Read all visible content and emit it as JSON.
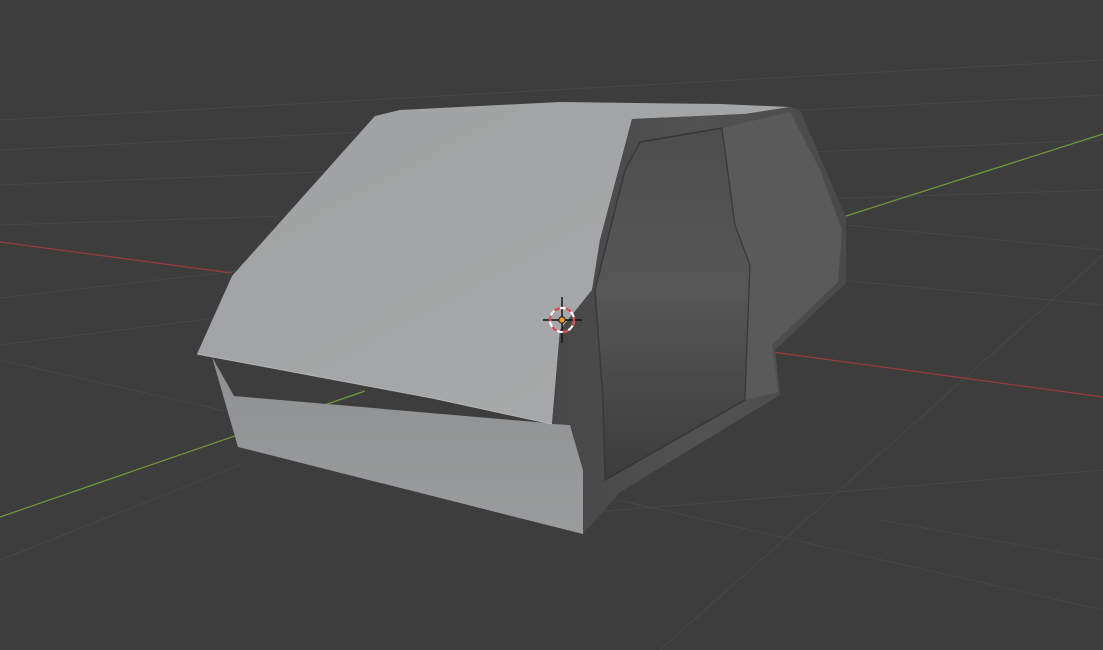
{
  "app": {
    "name": "3D viewport",
    "background_color": "#3d3d3d"
  },
  "viewport": {
    "grid": true,
    "axes": {
      "x_axis_color": "#9b3a3a",
      "y_axis_color": "#6e9a3a"
    },
    "object": {
      "kind": "car-body-mesh",
      "shading": "solid",
      "light_face_color": "#a3a5a6",
      "dark_face_color": "#505050"
    },
    "cursor": {
      "kind": "3d-cursor",
      "ring_colors": [
        "#ffffff",
        "#d24a4a"
      ]
    }
  }
}
